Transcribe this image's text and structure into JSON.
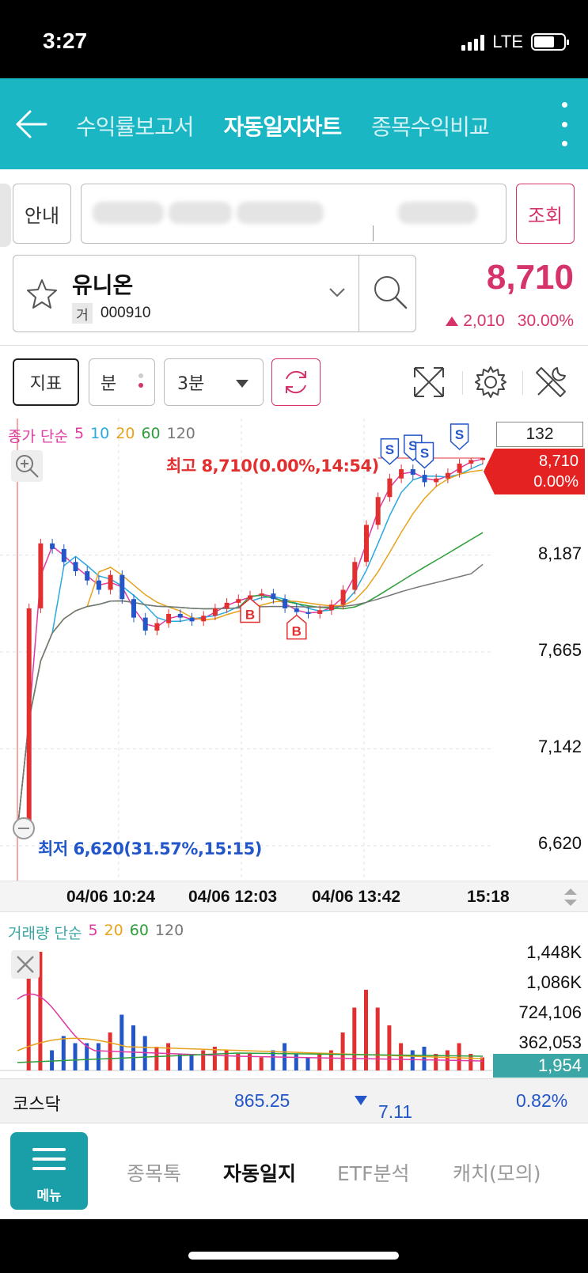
{
  "status_bar": {
    "time": "3:27",
    "network": "LTE"
  },
  "header": {
    "tabs": [
      {
        "label": "수익률보고서",
        "active": false
      },
      {
        "label": "자동일지차트",
        "active": true
      },
      {
        "label": "종목수익비교",
        "active": false
      }
    ]
  },
  "account": {
    "guide_label": "안내",
    "query_label": "조회"
  },
  "stock": {
    "name": "유니온",
    "market_tag": "거",
    "code": "000910",
    "price": "8,710",
    "change": "2,010",
    "change_pct": "30.00%"
  },
  "toolbar": {
    "indicator_label": "지표",
    "unit_label": "분",
    "interval_label": "3분"
  },
  "chart": {
    "legend_prefix": "종가 단순",
    "ma_labels": [
      "5",
      "10",
      "20",
      "60",
      "120"
    ],
    "count": "132",
    "current_price": "8,710",
    "current_pct": "0.00%",
    "high_annotation": "최고 8,710(0.00%,14:54)",
    "low_annotation": "최저 6,620(31.57%,15:15)",
    "y_labels": [
      "8,187",
      "7,665",
      "7,142",
      "6,620"
    ],
    "x_labels": [
      "04/06 10:24",
      "04/06 12:03",
      "04/06 13:42",
      "15:18"
    ],
    "signals": [
      "B",
      "B",
      "S",
      "S",
      "S",
      "S"
    ]
  },
  "volume": {
    "legend_prefix": "거래량 단순",
    "ma_labels": [
      "5",
      "20",
      "60",
      "120"
    ],
    "y_labels": [
      "1,448K",
      "1,086K",
      "724,106",
      "362,053"
    ],
    "current": "1,954"
  },
  "index_bar": {
    "name": "코스닥",
    "value": "865.25",
    "change": "7.11",
    "pct": "0.82%"
  },
  "bottom_nav": {
    "menu_label": "메뉴",
    "items": [
      {
        "label": "종목톡",
        "active": false
      },
      {
        "label": "자동일지",
        "active": true
      },
      {
        "label": "ETF분석",
        "active": false
      },
      {
        "label": "캐치(모의)",
        "active": false
      }
    ]
  },
  "colors": {
    "accent": "#1ab6c3",
    "up": "#d6336c",
    "down": "#2256c9",
    "ma5": "#e03aa0",
    "ma10": "#2aa8e0",
    "ma20": "#e8a21b",
    "ma60": "#2e9e3a",
    "ma120": "#777777"
  },
  "chart_data": {
    "type": "candlestick",
    "x_labels": [
      "04/06 10:24",
      "04/06 12:03",
      "04/06 13:42",
      "15:18"
    ],
    "ylim": [
      6620,
      8710
    ],
    "y_ticks": [
      8187,
      7665,
      7142,
      6620
    ],
    "close_series": [
      6700,
      7900,
      8250,
      8220,
      8150,
      8100,
      8050,
      8000,
      8080,
      7950,
      7850,
      7780,
      7820,
      7870,
      7850,
      7830,
      7860,
      7900,
      7930,
      7950,
      7970,
      7980,
      7950,
      7900,
      7880,
      7870,
      7890,
      7920,
      8000,
      8150,
      8350,
      8500,
      8600,
      8650,
      8620,
      8580,
      8600,
      8630,
      8680,
      8700,
      8710
    ],
    "signals": [
      {
        "type": "B",
        "x_index": 20
      },
      {
        "type": "B",
        "x_index": 24
      },
      {
        "type": "S",
        "x_index": 32
      },
      {
        "type": "S",
        "x_index": 34
      },
      {
        "type": "S",
        "x_index": 35
      },
      {
        "type": "S",
        "x_index": 38
      }
    ]
  }
}
